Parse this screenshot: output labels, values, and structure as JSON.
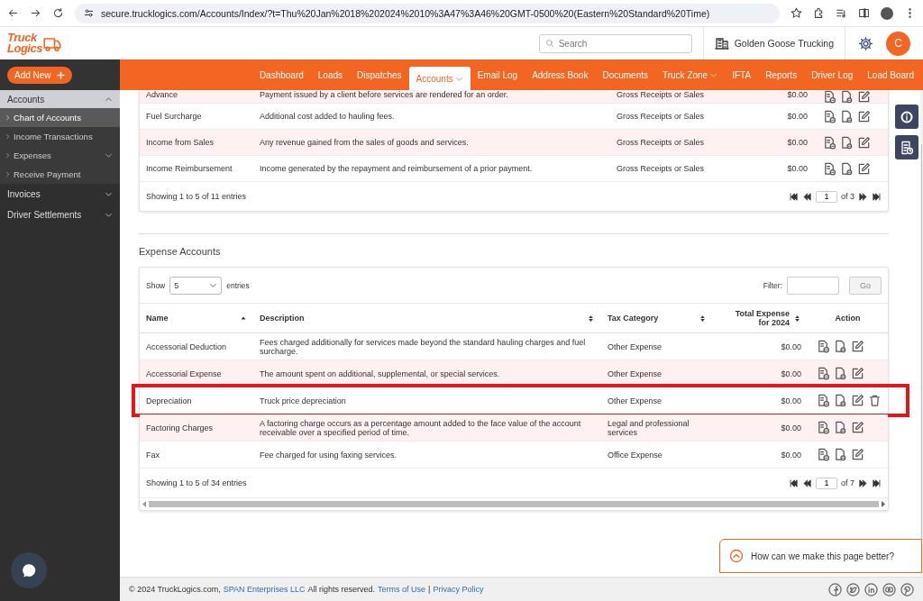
{
  "browser": {
    "url": "secure.trucklogics.com/Accounts/Index/?t=Thu%20Jan%2018%202024%2010%3A47%3A46%20GMT-0500%20(Eastern%20Standard%20Time)"
  },
  "header": {
    "logo": [
      "Truck",
      "Logics"
    ],
    "search": {
      "placeholder": "Search"
    },
    "company": "Golden Goose Trucking",
    "avatar": "C"
  },
  "sidebar": {
    "add_new": "Add New",
    "sections": [
      {
        "label": "Accounts",
        "expanded": true,
        "children": [
          {
            "label": "Chart of Accounts",
            "selected": true,
            "has_submenu": false
          },
          {
            "label": "Income Transactions",
            "selected": false,
            "has_submenu": false
          },
          {
            "label": "Expenses",
            "selected": false,
            "has_submenu": true
          },
          {
            "label": "Receive Payment",
            "selected": false,
            "has_submenu": false
          }
        ]
      },
      {
        "label": "Invoices",
        "expanded": false
      },
      {
        "label": "Driver Settlements",
        "expanded": false
      }
    ]
  },
  "nav": [
    {
      "label": "Dashboard",
      "selected": false,
      "dropdown": false
    },
    {
      "label": "Loads",
      "selected": false,
      "dropdown": false
    },
    {
      "label": "Dispatches",
      "selected": false,
      "dropdown": false
    },
    {
      "label": "Accounts",
      "selected": true,
      "dropdown": true
    },
    {
      "label": "Email Log",
      "selected": false,
      "dropdown": false
    },
    {
      "label": "Address Book",
      "selected": false,
      "dropdown": false
    },
    {
      "label": "Documents",
      "selected": false,
      "dropdown": false
    },
    {
      "label": "Truck Zone",
      "selected": false,
      "dropdown": true
    },
    {
      "label": "IFTA",
      "selected": false,
      "dropdown": false
    },
    {
      "label": "Reports",
      "selected": false,
      "dropdown": false
    },
    {
      "label": "Driver Log",
      "selected": false,
      "dropdown": false
    },
    {
      "label": "Load Board",
      "selected": false,
      "dropdown": false
    }
  ],
  "income_table": {
    "rows": [
      {
        "name": "Advance",
        "description": "Payment issued by a client before services are rendered for an order.",
        "tax_category": "Gross Receipts or Sales",
        "total": "$0.00",
        "deletable": false
      },
      {
        "name": "Fuel Surcharge",
        "description": "Additional cost added to hauling fees.",
        "tax_category": "Gross Receipts or Sales",
        "total": "$0.00",
        "deletable": false
      },
      {
        "name": "Income from Sales",
        "description": "Any revenue gained from the sales of goods and services.",
        "tax_category": "Gross Receipts or Sales",
        "total": "$0.00",
        "deletable": false
      },
      {
        "name": "Income Reimbursement",
        "description": "Income generated by the repayment and reimbursement of a prior payment.",
        "tax_category": "Gross Receipts or Sales",
        "total": "$0.00",
        "deletable": false
      }
    ],
    "info": "Showing 1 to 5 of 11 entries",
    "page": "1",
    "page_count": "of 3"
  },
  "expense_section": {
    "title": "Expense Accounts",
    "show_label": "Show",
    "page_size": "5",
    "entries_label": "entries",
    "filter_label": "Filter:",
    "go": "Go",
    "columns": [
      {
        "label": "Name",
        "sortable": true,
        "sorted_ascending": true
      },
      {
        "label": "Description",
        "sortable": true,
        "sorted_ascending": false
      },
      {
        "label": "Tax Category",
        "sortable": true,
        "sorted_ascending": false
      },
      {
        "label": "Total Expense for 2024",
        "sortable": true,
        "sorted_ascending": false
      },
      {
        "label": "Action",
        "sortable": false,
        "sorted_ascending": false
      }
    ],
    "rows": [
      {
        "name": "Accessorial Deduction",
        "description": "Fees charged additionally for services made beyond the standard hauling charges and fuel surcharge.",
        "tax_category": "Other Expense",
        "total": "$0.00",
        "deletable": false,
        "highlighted": false
      },
      {
        "name": "Accessorial Expense",
        "description": "The amount spent on additional, supplemental, or special services.",
        "tax_category": "Other Expense",
        "total": "$0.00",
        "deletable": false,
        "highlighted": false
      },
      {
        "name": "Depreciation",
        "description": "Truck price depreciation",
        "tax_category": "Other Expense",
        "total": "$0.00",
        "deletable": true,
        "highlighted": true
      },
      {
        "name": "Factoring Charges",
        "description": "A factoring charge occurs as a percentage amount added to the face value of the account receivable over a specified period of time.",
        "tax_category": "Legal and professional services",
        "total": "$0.00",
        "deletable": false,
        "highlighted": false
      },
      {
        "name": "Fax",
        "description": "Fee charged for using faxing services.",
        "tax_category": "Office Expense",
        "total": "$0.00",
        "deletable": false,
        "highlighted": false
      }
    ],
    "info": "Showing 1 to 5 of 34 entries",
    "page": "1",
    "page_count": "of 7"
  },
  "feedback": "How can we make this page better?",
  "footer": {
    "parts": [
      {
        "kind": "text",
        "text": "© 2024 TruckLogics.com,"
      },
      {
        "kind": "link",
        "text": "SPAN Enterprises LLC"
      },
      {
        "kind": "text",
        "text": "All rights reserved."
      },
      {
        "kind": "link",
        "text": "Terms of Use"
      },
      {
        "kind": "text",
        "text": "|"
      },
      {
        "kind": "link",
        "text": "Privacy Policy"
      }
    ]
  }
}
